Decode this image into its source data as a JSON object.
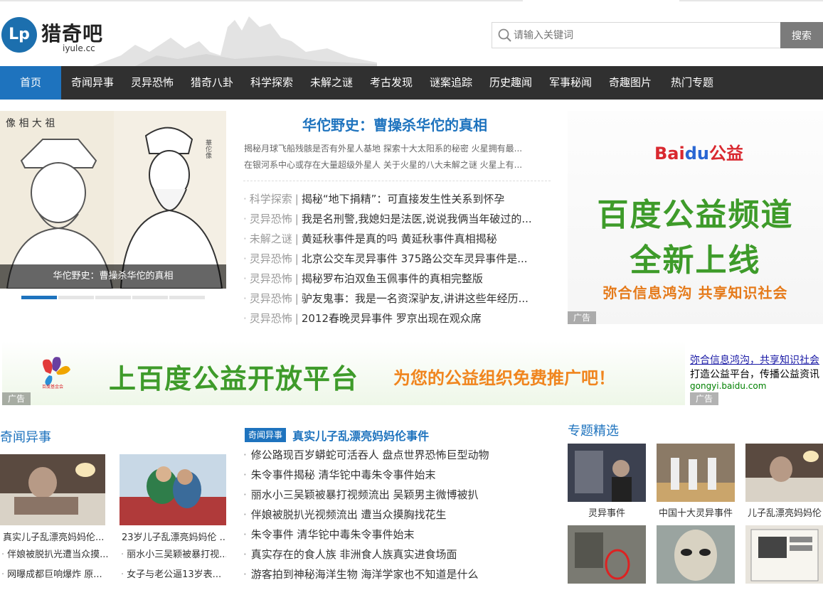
{
  "site": {
    "logo_cn": "猎奇吧",
    "logo_en": "iyule.cc",
    "logo_badge": "Lp"
  },
  "search": {
    "placeholder": "请输入关键词",
    "button": "搜索"
  },
  "nav": {
    "items": [
      "首页",
      "奇闻异事",
      "灵异恐怖",
      "猎奇八卦",
      "科学探索",
      "未解之谜",
      "考古发现",
      "谜案追踪",
      "历史趣闻",
      "军事秘闻",
      "奇趣图片",
      "热门专题"
    ],
    "active": "首页"
  },
  "slider": {
    "caption": "华佗野史：曹操杀华佗的真相",
    "dot_count": 5,
    "active_dot": 1
  },
  "headline": {
    "title": "华佗野史：曹操杀华佗的真相",
    "sub1": "揭秘月球飞船残骸是否有外星人基地   探索十大太阳系的秘密 火星拥有最...",
    "sub2": "在银河系中心或存在大量超级外星人   关于火星的八大未解之谜 火星上有..."
  },
  "news": [
    {
      "cat": "科学探索",
      "title": "揭秘“地下捐精”：可直接发生性关系到怀孕"
    },
    {
      "cat": "灵异恐怖",
      "title": "我是名刑警,我媳妇是法医,说说我俩当年破过的..."
    },
    {
      "cat": "未解之谜",
      "title": "黄延秋事件是真的吗 黄延秋事件真相揭秘"
    },
    {
      "cat": "灵异恐怖",
      "title": "北京公交车灵异事件 375路公交车灵异事件是..."
    },
    {
      "cat": "灵异恐怖",
      "title": "揭秘罗布泊双鱼玉佩事件的真相完整版"
    },
    {
      "cat": "灵异恐怖",
      "title": "驴友鬼事：我是一名资深驴友,讲讲这些年经历..."
    },
    {
      "cat": "灵异恐怖",
      "title": "2012春晚灵异事件 罗京出现在观众席"
    }
  ],
  "ad_right": {
    "brand_red": "Bai",
    "brand_blue": "du",
    "brand_tail": "公益",
    "line1": "百度公益频道",
    "line2": "全新上线",
    "slogan": "弥合信息鸿沟  共享知识社会",
    "tag": "广告"
  },
  "banner": {
    "org": "百度基金会",
    "text1": "上百度公益开放平台",
    "text2": "为您的公益组织免费推广吧！",
    "tag": "广告",
    "side_link": "弥合信息鸿沟，共享知识社会",
    "side_desc": "打造公益平台，传播公益资讯",
    "side_url": "gongyi.baidu.com",
    "side_tag": "广告"
  },
  "left_section": {
    "title": "奇闻异事",
    "cards": [
      {
        "caption": "真实儿子乱漂亮妈妈伦..."
      },
      {
        "caption": "23岁儿子乱漂亮妈妈伦 ..."
      }
    ],
    "mini": [
      [
        "伴娘被脱扒光遭当众摸...",
        "丽水小三吴颖被暴打视..."
      ],
      [
        "网曝成都巨响爆炸 原...",
        "女子与老公逼13岁表..."
      ]
    ]
  },
  "mid_section": {
    "tag": "奇闻异事",
    "title": "真实儿子乱漂亮妈妈伦事件",
    "items": [
      "修公路现百岁蟒蛇可活吞人 盘点世界恐怖巨型动物",
      "朱令事件揭秘 清华铊中毒朱令事件始末",
      "丽水小三吴颖被暴打视频流出 吴颖男主微博被扒",
      "伴娘被脱扒光视频流出 遭当众摸胸找花生",
      "朱令事件 清华铊中毒朱令事件始末",
      "真实存在的食人族 非洲食人族真实进食场面",
      "游客拍到神秘海洋生物 海洋学家也不知道是什么"
    ]
  },
  "topics": {
    "title": "专题精选",
    "items": [
      {
        "caption": "灵异事件"
      },
      {
        "caption": "中国十大灵异事件"
      },
      {
        "caption": "儿子乱漂亮妈妈伦"
      }
    ]
  },
  "colors": {
    "accent": "#1e73be",
    "nav_bg": "#303030",
    "green": "#3e9b2a",
    "orange": "#f0851e"
  }
}
